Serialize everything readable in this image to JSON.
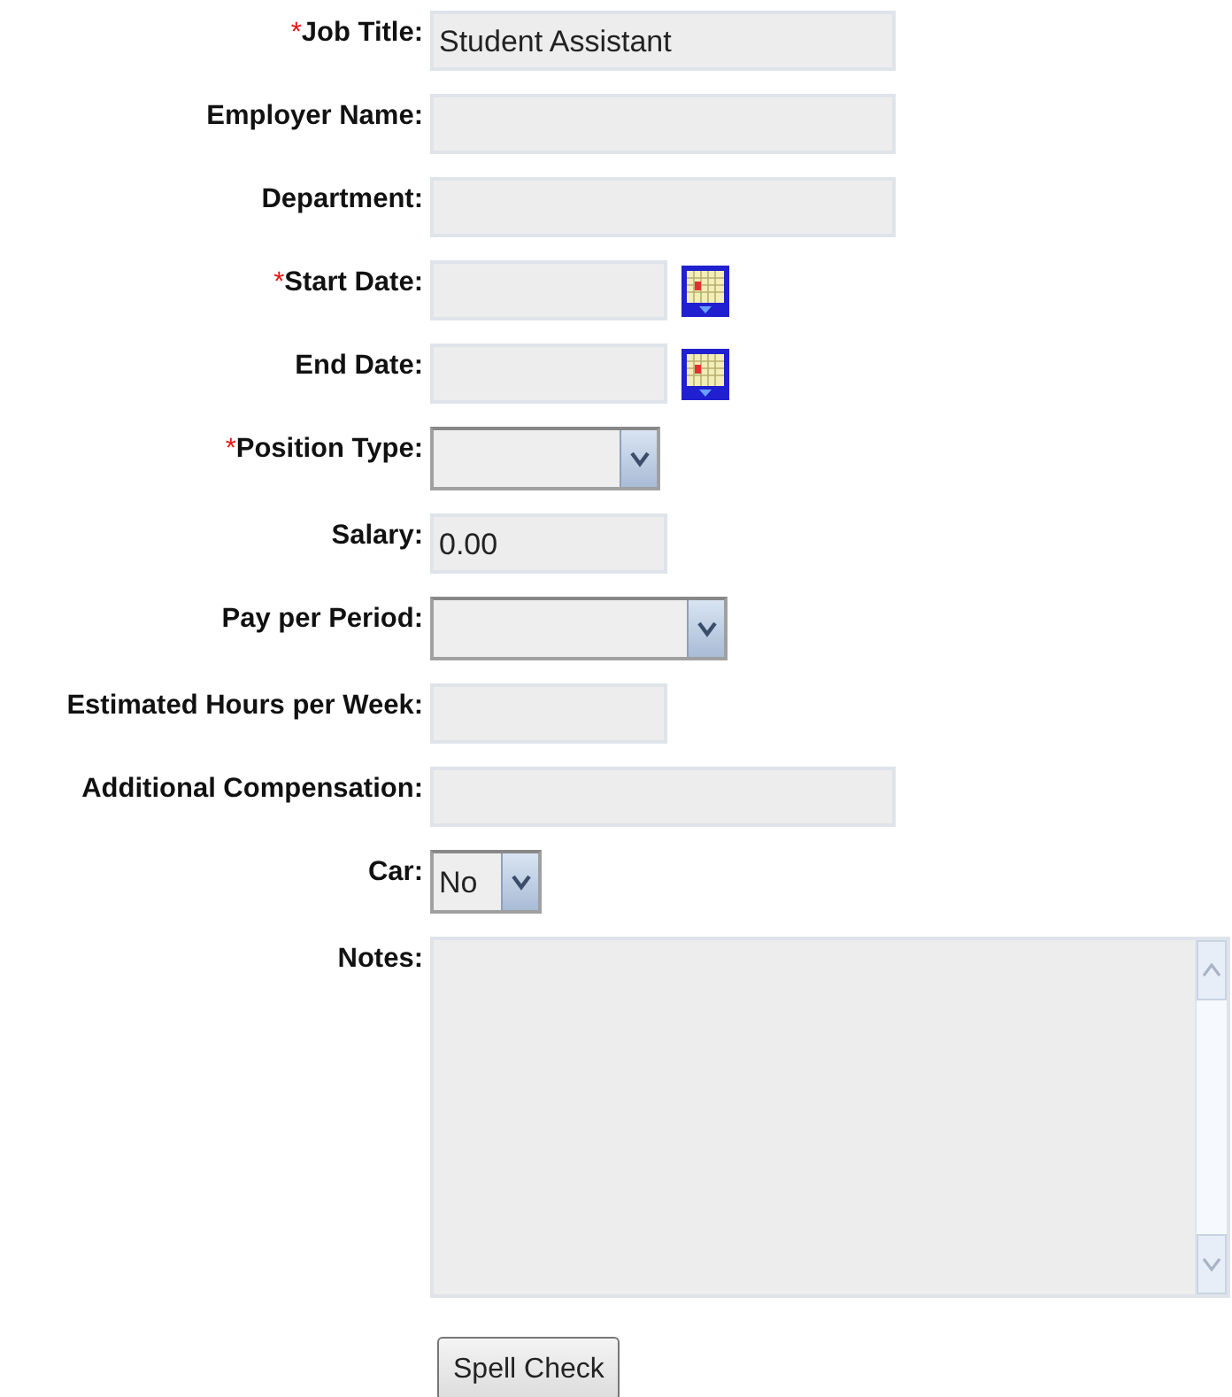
{
  "fields": [
    {
      "label": "Job Title:",
      "marker": "*",
      "kind": "text",
      "value": "Student Assistant"
    },
    {
      "label": "Employer Name:",
      "kind": "text"
    },
    {
      "label": "Department:",
      "kind": "text"
    },
    {
      "label": "Start Date:",
      "marker": "*",
      "kind": "date"
    },
    {
      "label": "End Date:",
      "kind": "date"
    },
    {
      "label": "Position Type:",
      "marker": "*",
      "kind": "select"
    },
    {
      "label": "Salary:",
      "kind": "short-text",
      "value": "0.00"
    },
    {
      "label": "Pay per Period:",
      "kind": "select"
    },
    {
      "label": "Estimated Hours per Week:",
      "kind": "short-text"
    },
    {
      "label": "Additional Compensation:",
      "kind": "text"
    },
    {
      "label": "Car:",
      "kind": "select",
      "value": "No"
    },
    {
      "label": "Notes:",
      "kind": "textarea"
    }
  ],
  "button": "Spell Check"
}
